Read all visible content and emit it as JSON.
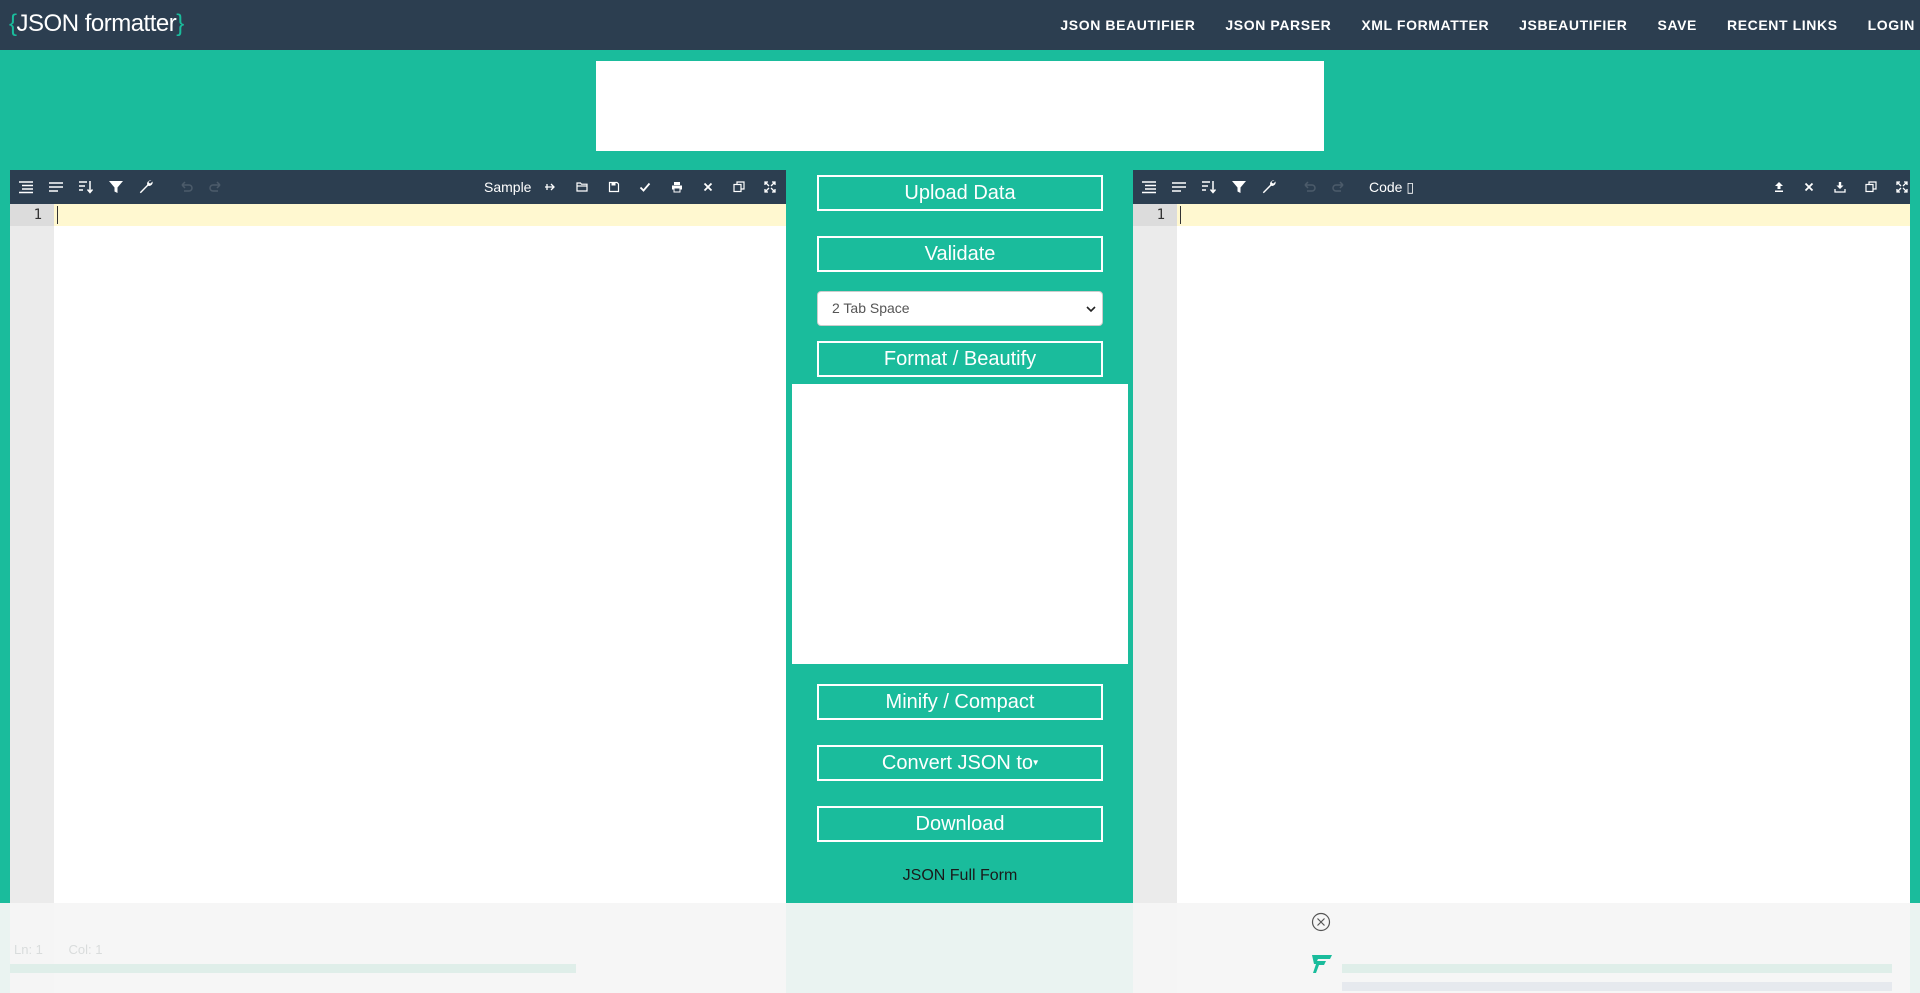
{
  "header": {
    "logo_open": "{",
    "logo_text": "JSON formatter",
    "logo_close": "}",
    "nav": [
      "JSON BEAUTIFIER",
      "JSON PARSER",
      "XML FORMATTER",
      "JSBEAUTIFIER",
      "SAVE",
      "RECENT LINKS",
      "LOGIN"
    ]
  },
  "left_editor": {
    "toolbar": {
      "sample_label": "Sample",
      "icons": [
        "format-icon",
        "compact-icon",
        "sort-icon",
        "filter-icon",
        "repair-icon",
        "undo-icon",
        "redo-icon",
        "load-url-icon",
        "open-file-icon",
        "save-icon",
        "validate-icon",
        "print-icon",
        "clear-icon",
        "copy-icon",
        "fullscreen-icon"
      ]
    },
    "line_numbers": [
      "1"
    ]
  },
  "right_editor": {
    "toolbar": {
      "view_label": "Code ▯",
      "icons": [
        "format-icon",
        "compact-icon",
        "sort-icon",
        "filter-icon",
        "repair-icon",
        "undo-icon",
        "redo-icon",
        "upload-icon",
        "clear-icon",
        "download-icon",
        "copy-icon",
        "fullscreen-icon"
      ]
    },
    "line_numbers": [
      "1"
    ]
  },
  "middle": {
    "upload_label": "Upload Data",
    "validate_label": "Validate",
    "indent_selected": "2 Tab Space",
    "format_label": "Format / Beautify",
    "minify_label": "Minify / Compact",
    "convert_label": "Convert JSON to",
    "download_label": "Download",
    "full_form_label": "JSON Full Form"
  },
  "status_bar": {
    "line": "Ln: 1",
    "col": "Col: 1"
  },
  "colors": {
    "accent": "#1abc9c",
    "nav_bg": "#2c3e50",
    "active_line": "#fff8d0"
  }
}
